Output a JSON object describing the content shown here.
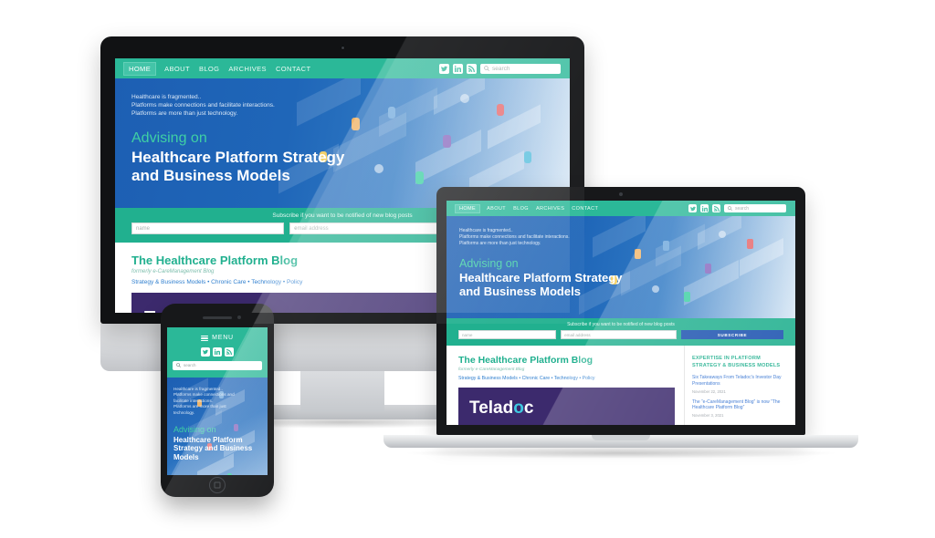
{
  "site": {
    "nav": {
      "items": [
        {
          "label": "HOME",
          "active": true
        },
        {
          "label": "ABOUT",
          "active": false
        },
        {
          "label": "BLOG",
          "active": false
        },
        {
          "label": "ARCHIVES",
          "active": false
        },
        {
          "label": "CONTACT",
          "active": false
        }
      ],
      "social": [
        {
          "name": "twitter-icon",
          "glyph": "🐦"
        },
        {
          "name": "linkedin-icon",
          "glyph": "in"
        },
        {
          "name": "rss-icon",
          "glyph": "◔"
        }
      ],
      "search_placeholder": "search",
      "mobile_menu_label": "MENU"
    },
    "hero": {
      "line1": "Healthcare is fragmented..",
      "line2": "Platforms make connections and facilitate interactions.",
      "line3": "Platforms are more than just technology.",
      "kicker": "Advising on",
      "title_line1": "Healthcare Platform Strategy",
      "title_line2": "and Business Models",
      "title_mobile_line1": "Healthcare Platform",
      "title_mobile_line2": "Strategy and Business",
      "title_mobile_line3": "Models"
    },
    "subscribe": {
      "note": "Subscribe if you want to be notified of new blog posts",
      "name_placeholder": "name",
      "email_placeholder": "email address",
      "button_label": "SUBSCRIBE"
    },
    "blog": {
      "title": "The Healthcare Platform Blog",
      "subtitle": "formerly e-CareManagement Blog",
      "tags": "Strategy & Business Models • Chronic Care • Technology • Policy",
      "promo_logo": "Teladoc"
    },
    "sidebar": {
      "heading_line1": "EXPERTISE IN PLATFORM",
      "heading_line2": "STRATEGY & BUSINESS MODELS",
      "items": [
        {
          "title": "Six Takeaways From Teladoc's Investor Day Presentations",
          "date": "November 22, 2021"
        },
        {
          "title": "The “e-CareManagement Blog” is now “The Healthcare Platform Blog”",
          "date": "November 3, 2021"
        }
      ]
    }
  },
  "colors": {
    "teal": "#2bb898",
    "teal_dark": "#21b08f",
    "blue": "#1d5fb3",
    "blue_button": "#1d53b0",
    "green_accent": "#3fd0a4",
    "purple": "#3c2a6d",
    "link_blue": "#2f6fd0"
  },
  "devices": [
    {
      "name": "desktop-monitor"
    },
    {
      "name": "laptop"
    },
    {
      "name": "smartphone"
    }
  ]
}
